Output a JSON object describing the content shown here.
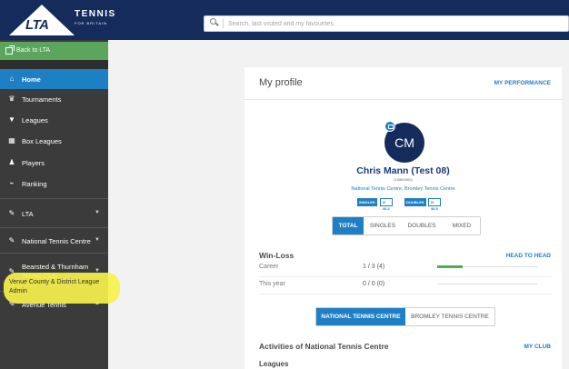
{
  "header": {
    "logo": {
      "lta": "LTA",
      "tennis": "TENNIS",
      "tagline": "FOR BRITAIN"
    },
    "search": {
      "placeholder": "Search, last visited and my favourites",
      "icon": "search-icon"
    }
  },
  "sidebar": {
    "back": {
      "label": "Back to LTA",
      "icon": "external-link-icon"
    },
    "items": [
      {
        "label": "Home",
        "icon": "home-icon",
        "active": true
      },
      {
        "label": "Tournaments",
        "icon": "trophy-icon"
      },
      {
        "label": "Leagues",
        "icon": "cup-icon"
      },
      {
        "label": "Box Leagues",
        "icon": "grid-icon"
      },
      {
        "label": "Players",
        "icon": "users-icon"
      },
      {
        "label": "Ranking",
        "icon": "chart-icon"
      }
    ],
    "groups": [
      {
        "label": "LTA",
        "icon": "wrench-icon"
      },
      {
        "label": "National Tennis Centre",
        "icon": "wrench-icon"
      },
      {
        "label": "Bearsted & Thurnham Tennis Club",
        "icon": "wrench-icon"
      },
      {
        "label": "Avenue Tennis",
        "icon": "wrench-icon"
      }
    ],
    "highlighted_item": "Venue County & District League Admin"
  },
  "profile": {
    "title": "My profile",
    "performance_link": "MY PERFORMANCE",
    "initials": "CM",
    "name": "Chris Mann (Test 08)",
    "member_number": "(10860900)",
    "clubs": "National Tennis Centre, Bromley Tennis Centre",
    "ratings": {
      "singles_label": "SINGLES",
      "singles_value": "N 40.2",
      "doubles_label": "DOUBLES",
      "doubles_value": "N 40.5"
    },
    "tabs": [
      "TOTAL",
      "SINGLES",
      "DOUBLES",
      "MIXED"
    ],
    "active_tab": "TOTAL",
    "win_loss": {
      "title": "Win-Loss",
      "head_to_head_link": "HEAD TO HEAD",
      "rows": [
        {
          "label": "Career",
          "value": "1 / 3 (4)",
          "win_ratio": 0.25
        },
        {
          "label": "This year",
          "value": "0 / 0 (0)",
          "win_ratio": 0
        }
      ]
    },
    "club_tabs": [
      "NATIONAL TENNIS CENTRE",
      "BROMLEY TENNIS CENTRE"
    ],
    "active_club_tab": "NATIONAL TENNIS CENTRE",
    "activities": {
      "title": "Activities of National Tennis Centre",
      "my_club_link": "MY CLUB",
      "first_section": "Leagues"
    }
  },
  "colors": {
    "header_bg": "#152b5c",
    "sidebar_bg": "#3b3b3b",
    "active_blue": "#1f7fc4",
    "back_green": "#5aa65c",
    "highlight_yellow": "#f7f24c"
  }
}
